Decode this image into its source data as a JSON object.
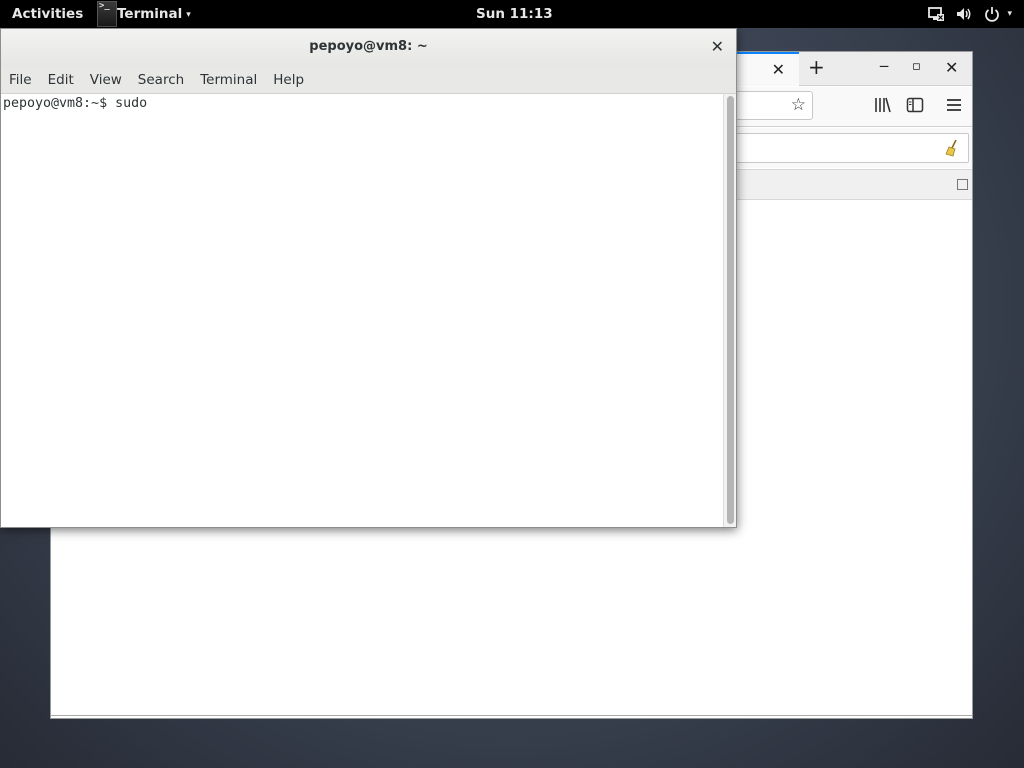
{
  "topbar": {
    "activities": "Activities",
    "app_icon_glyph": ">_",
    "app_name": "Terminal",
    "app_caret": "▾",
    "clock": "Sun 11:13",
    "sys_caret": "▾",
    "icons": [
      "network-wired-icon",
      "volume-icon",
      "power-icon"
    ]
  },
  "browser": {
    "tab_close": "✕",
    "new_tab": "+",
    "minimize": "‒",
    "maximize": "▫",
    "close": "✕",
    "bookmark_star": "☆",
    "toolbar_icons": [
      "library-icon",
      "sidebar-icon",
      "hamburger-menu-icon"
    ]
  },
  "terminal": {
    "title": "pepoyo@vm8: ~",
    "close": "✕",
    "menu": [
      "File",
      "Edit",
      "View",
      "Search",
      "Terminal",
      "Help"
    ],
    "prompt": "pepoyo@vm8:~$ ",
    "command": "sudo"
  },
  "colors": {
    "topbar_bg": "#000000",
    "firefox_tab_accent": "#0a84ff",
    "desktop_bg": "#3f4858"
  }
}
